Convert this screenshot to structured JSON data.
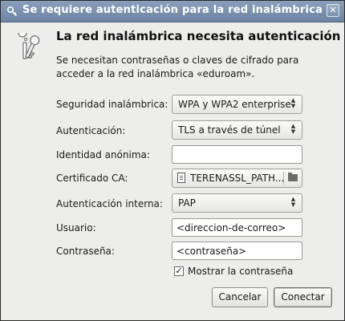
{
  "window": {
    "title": "Se requiere autenticación para la red inalámbrica",
    "close_glyph": "✕"
  },
  "icons": {
    "title_icon": "key-icon",
    "dialog_icon": "keys-icon",
    "close_icon": "close-icon"
  },
  "dialog": {
    "heading": "La red inalámbrica necesita autenticación",
    "description": "Se necesitan contraseñas o claves de cifrado para acceder a la red inalámbrica «eduroam»."
  },
  "form": {
    "security_label": "Seguridad inalámbrica:",
    "security_value": "WPA y WPA2 enterprise",
    "auth_label": "Autenticación:",
    "auth_value": "TLS a través de túnel",
    "anon_identity_label": "Identidad anónima:",
    "anon_identity_value": "",
    "ca_cert_label": "Certificado CA:",
    "ca_cert_value": "TERENASSL_PATH...",
    "inner_auth_label": "Autenticación interna:",
    "inner_auth_value": "PAP",
    "user_label": "Usuario:",
    "user_value": "<direccion-de-correo>",
    "password_label": "Contraseña:",
    "password_value": "<contraseña>",
    "show_password_label": "Mostrar la contraseña",
    "show_password_checked": true
  },
  "buttons": {
    "cancel": "Cancelar",
    "connect": "Conectar"
  },
  "colors": {
    "titlebar": "#7a90ae",
    "dialog_bg": "#ededeb"
  }
}
